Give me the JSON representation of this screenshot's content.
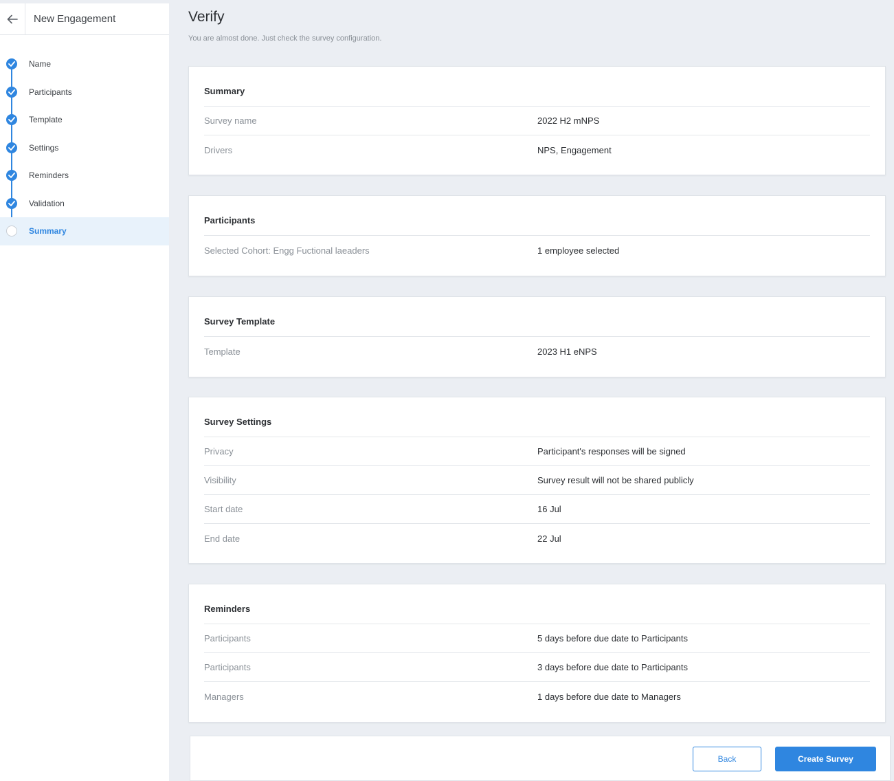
{
  "sidebar": {
    "title": "New Engagement",
    "steps": [
      {
        "label": "Name"
      },
      {
        "label": "Participants"
      },
      {
        "label": "Template"
      },
      {
        "label": "Settings"
      },
      {
        "label": "Reminders"
      },
      {
        "label": "Validation"
      },
      {
        "label": "Summary"
      }
    ]
  },
  "header": {
    "title": "Verify",
    "subtitle": "You are almost done. Just check the survey configuration."
  },
  "cards": {
    "summary": {
      "title": "Summary",
      "rows": [
        {
          "label": "Survey name",
          "value": "2022 H2 mNPS"
        },
        {
          "label": "Drivers",
          "value": "NPS, Engagement"
        }
      ]
    },
    "participants": {
      "title": "Participants",
      "rows": [
        {
          "label": "Selected Cohort: Engg Fuctional laeaders",
          "value": "1 employee selected"
        }
      ]
    },
    "template": {
      "title": "Survey Template",
      "rows": [
        {
          "label": "Template",
          "value": "2023 H1 eNPS"
        }
      ]
    },
    "settings": {
      "title": "Survey Settings",
      "rows": [
        {
          "label": "Privacy",
          "value": "Participant's responses will be signed"
        },
        {
          "label": "Visibility",
          "value": "Survey result will not be shared publicly"
        },
        {
          "label": "Start date",
          "value": "16 Jul"
        },
        {
          "label": "End date",
          "value": "22 Jul"
        }
      ]
    },
    "reminders": {
      "title": "Reminders",
      "rows": [
        {
          "label": "Participants",
          "value": "5 days before due date to Participants"
        },
        {
          "label": "Participants",
          "value": "3 days before due date to Participants"
        },
        {
          "label": "Managers",
          "value": "1 days before due date to Managers"
        }
      ]
    }
  },
  "footer": {
    "back_label": "Back",
    "create_label": "Create Survey"
  },
  "colors": {
    "accent": "#2f86e0",
    "background": "#ebeef3",
    "active_step_bg": "#e8f2fb"
  },
  "icons": {
    "back": "arrow-left-icon",
    "step_done": "check-circle-icon",
    "step_pending": "empty-circle-icon"
  }
}
